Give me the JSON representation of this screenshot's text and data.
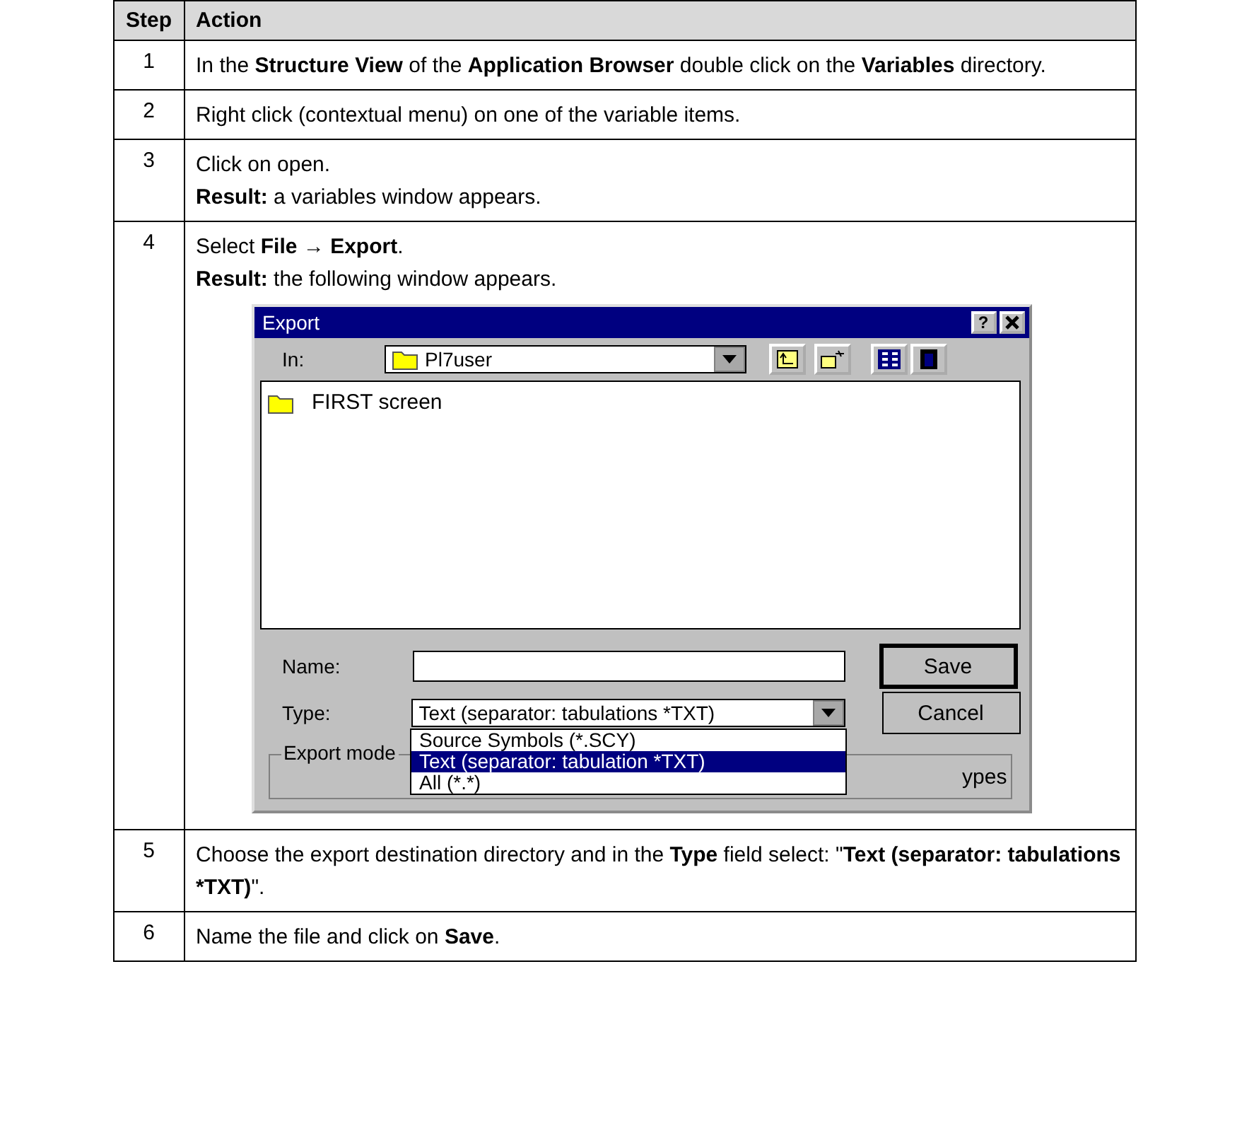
{
  "table": {
    "columns": [
      "Step",
      "Action"
    ],
    "rows": [
      {
        "step": "1",
        "paragraphs": [
          "In the **Structure View** of the **Application Browser** double click on the **Variables** directory."
        ]
      },
      {
        "step": "2",
        "paragraphs": [
          "Right click (contextual menu) on one of the variable items."
        ]
      },
      {
        "step": "3",
        "paragraphs": [
          "Click on open.",
          "**Result:** a variables window appears."
        ]
      },
      {
        "step": "4",
        "paragraphs": [
          "Select **File** → **Export**.",
          "**Result:** the following window appears."
        ],
        "dialog": {
          "title": "Export",
          "help_button": "?",
          "look_in": {
            "label": "In:",
            "value": "Pl7user"
          },
          "files": [
            {
              "name": "FIRST screen"
            }
          ],
          "name_field": {
            "label": "Name:"
          },
          "type_field": {
            "label": "Type:",
            "value": "Text (separator: tabulations *TXT)",
            "expanded": true,
            "options": [
              {
                "label": "Source Symbols (*.SCY)",
                "selected": false
              },
              {
                "label": "Text (separator: tabulation *TXT)",
                "selected": true
              },
              {
                "label": "All (*.*)",
                "selected": false
              }
            ]
          },
          "buttons": [
            {
              "label": "Save",
              "default": true
            },
            {
              "label": "Cancel",
              "default": false
            }
          ],
          "export_mode": {
            "label": "Export mode",
            "text": "ypes"
          }
        }
      },
      {
        "step": "5",
        "paragraphs": [
          "Choose the export destination directory and in the **Type** field select: \"**Text (separator: tabulations *TXT)**\"."
        ]
      },
      {
        "step": "6",
        "paragraphs": [
          "Name the file and click on **Save**."
        ]
      }
    ]
  }
}
